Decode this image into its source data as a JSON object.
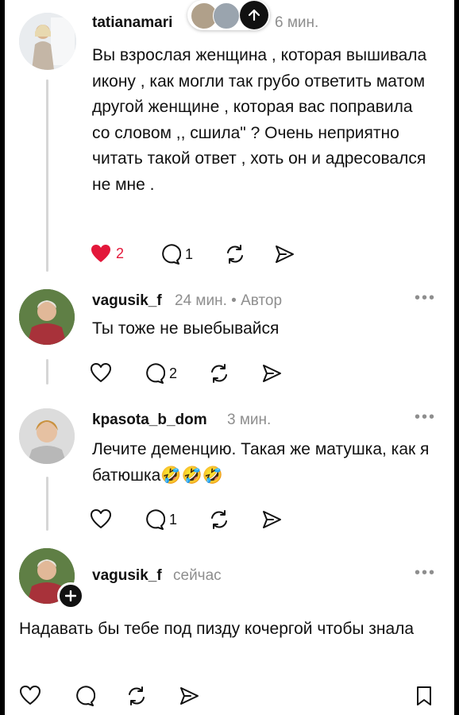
{
  "comments": [
    {
      "username": "tatianamari",
      "time": "6 мин.",
      "text": "Вы взрослая женщина , которая вышивала икону , как могли так грубо ответить матом другой женщине , которая вас поправила со словом ,, сшила\" ? Очень неприятно читать такой ответ , хоть он и адресовался не мне .",
      "likes": "2",
      "replies": "1",
      "liked": true
    },
    {
      "username": "vagusik_f",
      "time": "24 мин.",
      "author_badge": "• Автор",
      "text": "Ты тоже не выебывайся",
      "replies": "2"
    },
    {
      "username": "kpasota_b_dom",
      "time": "3 мин.",
      "text": "Лечите деменцию. Такая же матушка, как я батюшка🤣🤣🤣",
      "replies": "1"
    },
    {
      "username": "vagusik_f",
      "time": "сейчас",
      "text": "Надавать бы тебе под пизду кочергой чтобы знала"
    }
  ],
  "more_label": "•••",
  "colors": {
    "like_red": "#e3173a",
    "meta_gray": "#8e8e8e",
    "thread_gray": "#d6d6d6"
  }
}
